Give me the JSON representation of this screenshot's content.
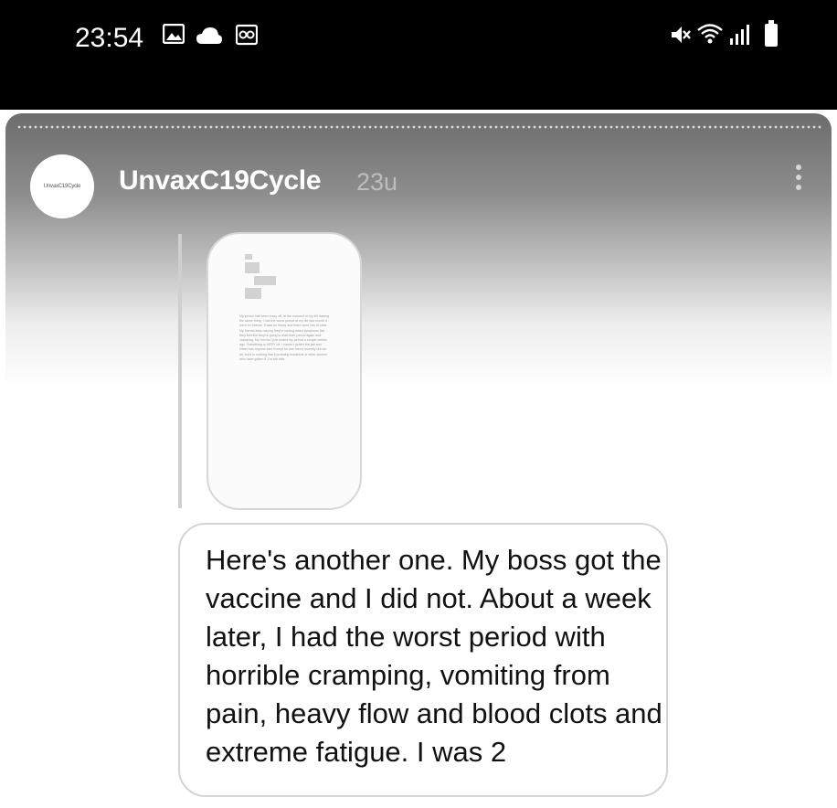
{
  "status_bar": {
    "time": "23:54",
    "left_icons": [
      "image-icon",
      "cloud-icon",
      "owl-icon"
    ],
    "right_icons": [
      "mute-icon",
      "wifi-icon",
      "signal-icon",
      "battery-icon"
    ]
  },
  "story": {
    "avatar_text": "UnvaxC19Cycle",
    "username": "UnvaxC19Cycle",
    "time_ago": "23u",
    "menu_icon": "more-vertical-icon"
  },
  "shared_post": {
    "thumbnail_text": "My period has been crazy off, at the moment in my life basing the same thing. I had the worst period of my life last month it went on forever. It was so heavy and there were lots of clots. My friends keep saying they're having weird symptoms like they feel like they're going to start their period again and cramping. My hm too I just ended my period a couple weeks ago. Something is VERY off. I haven't gotten the jab and either has anyone else except for one friend recently but we all, but it is nothing that it probably hundreds of other women who have gotten it. I'm still sick."
  },
  "message": {
    "text": "Here's another one. My boss got the vaccine and I did not. About a week later, I had the worst period with horrible cramping, vomiting from pain, heavy flow and blood clots and extreme fatigue. I was 2"
  }
}
